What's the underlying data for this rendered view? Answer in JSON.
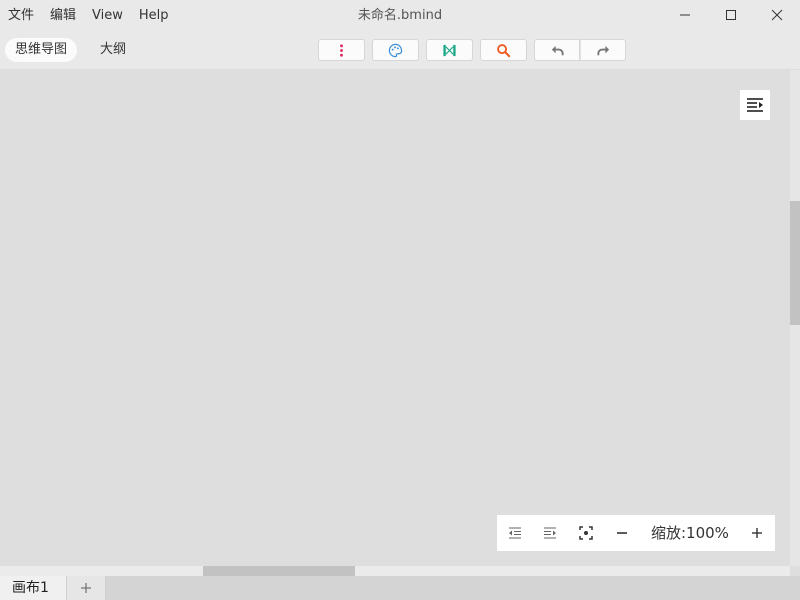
{
  "menu": {
    "file": "文件",
    "edit": "编辑",
    "view": "View",
    "help": "Help"
  },
  "document": {
    "title": "未命名.bmind"
  },
  "window_controls": [
    "minimize-icon",
    "maximize-icon",
    "close-icon"
  ],
  "view_tabs": {
    "mindmap": "思维导图",
    "outline": "大纲",
    "active": "mindmap"
  },
  "toolbar": {
    "buttons": [
      "more-vertical-icon",
      "palette-icon",
      "structure-icon",
      "search-icon",
      "undo-icon",
      "redo-icon"
    ],
    "colors": {
      "more": "#e0245e",
      "palette": "#3a8fd6",
      "structure": "#1ea88a",
      "search": "#f05a22",
      "undo_redo": "#777777"
    }
  },
  "zoom": {
    "label": "缩放:100%",
    "level_percent": 100
  },
  "sheets": {
    "tabs": [
      "画布1"
    ],
    "active": "画布1"
  }
}
